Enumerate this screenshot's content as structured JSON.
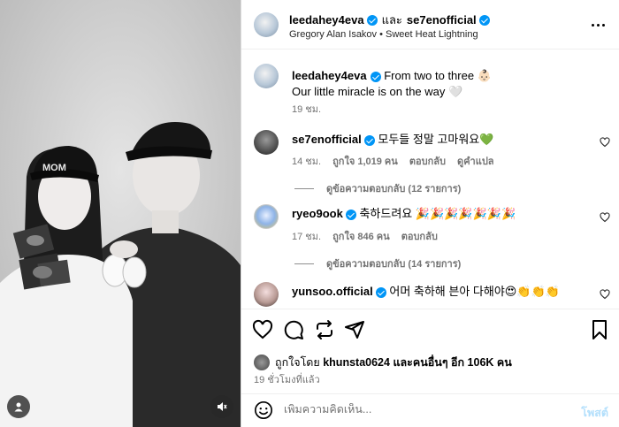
{
  "post": {
    "header": {
      "author": "leedahey4eva",
      "conjunction": "และ",
      "coauthor": "se7enofficial",
      "audio": "Gregory Alan Isakov • Sweet Heat Lightning"
    },
    "caption": {
      "user": "leedahey4eva",
      "line1": "From two to three 👶🏻",
      "line2": "Our little miracle is on the way 🤍",
      "time": "19 ชม."
    },
    "comments": [
      {
        "user": "se7enofficial",
        "text": "모두들 정말 고마워요💚",
        "time": "14 ชม.",
        "likes": "ถูกใจ 1,019 คน",
        "reply": "ตอบกลับ",
        "translate": "ดูคำแปล",
        "replies": "ดูข้อความตอบกลับ (12 รายการ)"
      },
      {
        "user": "ryeo9ook",
        "text": "축하드려요 🎉🎉🎉🎉🎉🎉🎉",
        "time": "17 ชม.",
        "likes": "ถูกใจ 846 คน",
        "reply": "ตอบกลับ",
        "replies": "ดูข้อความตอบกลับ (14 รายการ)"
      },
      {
        "user": "yunsoo.official",
        "text": "어머 축하해 븐아 다해야😍👏👏👏"
      }
    ],
    "liked_by": {
      "prefix": "ถูกใจโดย",
      "user": "khunsta0624",
      "suffix": "และคนอื่นๆ อีก 106K คน"
    },
    "posted": "19 ชั่วโมงที่แล้ว",
    "comment_input": {
      "placeholder": "เพิ่มความคิดเห็น...",
      "post_label": "โพสต์"
    }
  },
  "icons": {
    "tag": "user-tag-icon",
    "mute": "volume-muted-icon",
    "more": "more-options-icon",
    "like": "heart-icon",
    "comment": "comment-icon",
    "repost": "repost-icon",
    "share": "send-icon",
    "save": "bookmark-icon",
    "emoji": "emoji-icon"
  },
  "colors": {
    "verified": "#0095f6",
    "muted_text": "#737373",
    "post_button": "#b2dffc"
  }
}
